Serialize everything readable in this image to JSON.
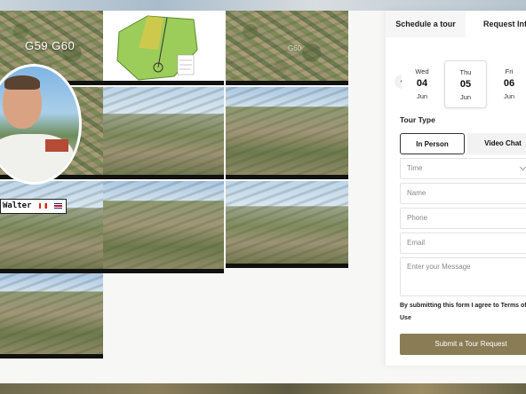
{
  "gallery": {
    "top_left_label": "G59 G60",
    "top_right_label": "G60",
    "presenter_name": "Walter",
    "flags": [
      "canada-flag",
      "costa-rica-flag"
    ]
  },
  "tour_panel": {
    "tabs": [
      "Schedule a tour",
      "Request Info"
    ],
    "dates": [
      {
        "day": "Wed",
        "num": "04",
        "month": "Jun"
      },
      {
        "day": "Thu",
        "num": "05",
        "month": "Jun"
      },
      {
        "day": "Fri",
        "num": "06",
        "month": "Jun"
      }
    ],
    "tour_type_label": "Tour Type",
    "tour_types": [
      "In Person",
      "Video Chat"
    ],
    "fields": {
      "time": "Time",
      "name": "Name",
      "phone": "Phone",
      "email": "Email",
      "message": "Enter your Message"
    },
    "terms_text": "By submitting this form I agree to Terms of Use",
    "submit_label": "Submit a Tour Request"
  }
}
